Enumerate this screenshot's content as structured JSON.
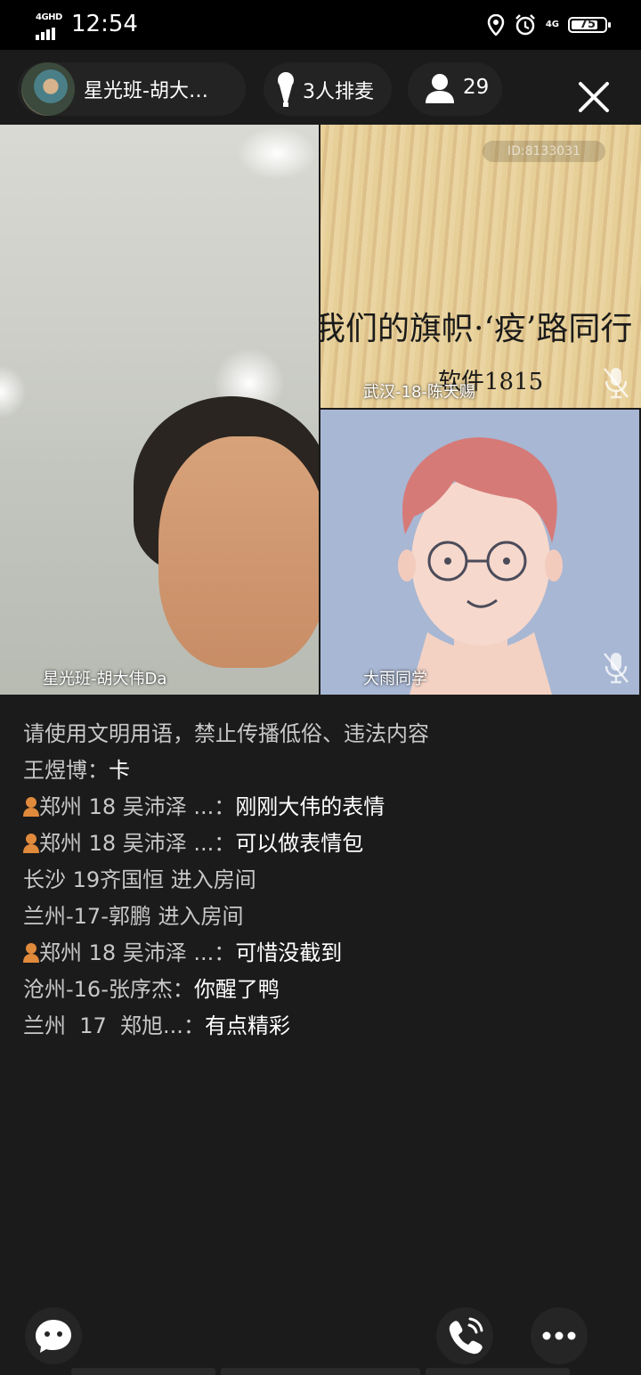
{
  "status_bar": {
    "network": "4GHD",
    "time": "12:54",
    "battery": "75",
    "cell_type": "4G"
  },
  "top_bar": {
    "host_name": "星光班-胡大…",
    "queue_label": "3人排麦",
    "audience_count": "29"
  },
  "videos": {
    "main_name": "星光班-胡大伟Da",
    "top_right": {
      "name": "武汉-18-陈天赐",
      "slide_id": "ID:8133031",
      "slide_title": "我们的旗帜·‘疫’路同行",
      "slide_subtitle": "软件1815"
    },
    "bottom_right_name": "大雨同学"
  },
  "chat": {
    "notice": "请使用文明用语，禁止传播低俗、违法内容",
    "messages": [
      {
        "sender": "王煜博：",
        "text": "卡",
        "badge": false
      },
      {
        "sender": "郑州 18 吴沛泽 ...：",
        "text": "刚刚大伟的表情",
        "badge": true
      },
      {
        "sender": "郑州 18 吴沛泽 ...：",
        "text": "可以做表情包",
        "badge": true
      },
      {
        "sender": "长沙 19齐国恒 进入房间",
        "text": "",
        "badge": false
      },
      {
        "sender": "兰州-17-郭鹏 进入房间",
        "text": "",
        "badge": false
      },
      {
        "sender": "郑州 18 吴沛泽 ...：",
        "text": "可惜没截到",
        "badge": true
      },
      {
        "sender": "沧州-16-张序杰：",
        "text": "你醒了鸭",
        "badge": false
      },
      {
        "sender": "兰州  17  郑旭...：",
        "text": "有点精彩",
        "badge": false
      }
    ]
  },
  "bottom_bar": {
    "icons": [
      "emoji-chat-icon",
      "phone-call-icon",
      "more-icon"
    ]
  },
  "colors": {
    "background": "#1b1b1b",
    "pill": "#232323",
    "chat_text": "#c8c8c8"
  }
}
